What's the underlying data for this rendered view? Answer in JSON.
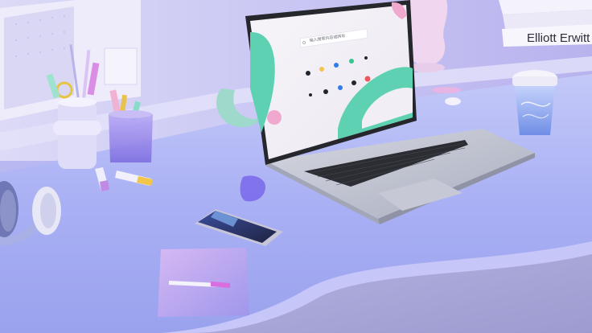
{
  "scene": {
    "book_spine_text": "Elliott Erwitt Sna",
    "browser_search_placeholder": "输入搜索内容或网址",
    "colors": {
      "wall": "#c9c6f3",
      "desk_top": "#a9b0f4",
      "desk_edge": "#c7c6f8",
      "floor": "#a8a7d8",
      "laptop_body": "#bfc2cf",
      "keyboard": "#2b2d33",
      "screen_bg": "#f2eef6",
      "screen_accent": "#5ed1b3",
      "screen_pink": "#f0a8cf",
      "cup": "#8fb0ee",
      "paper_pad": "#b7a6f0"
    },
    "objects": [
      "pencil-cup-white",
      "pencil-cup-purple",
      "headphones",
      "smartphone",
      "laptop",
      "coffee-cup",
      "book-stack",
      "vase",
      "note-pad",
      "highlighter",
      "decor-ring"
    ]
  }
}
